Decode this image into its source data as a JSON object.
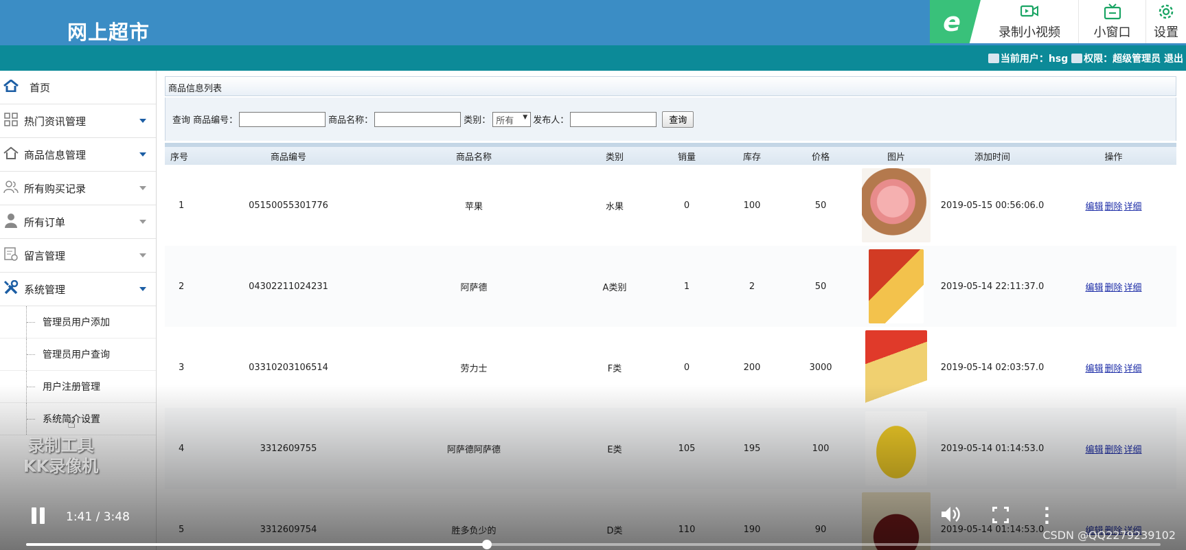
{
  "header": {
    "title": "网上超市",
    "toolbar": {
      "logo": "e",
      "record_label": "录制小视频",
      "mini_label": "小窗口",
      "settings_label": "设置"
    }
  },
  "userbar": {
    "user_label": "当前用户：hsg",
    "role_label": "权限：超级管理员",
    "logout_label": "退出"
  },
  "sidebar": {
    "items": [
      {
        "label": "首页"
      },
      {
        "label": "热门资讯管理"
      },
      {
        "label": "商品信息管理"
      },
      {
        "label": "所有购买记录"
      },
      {
        "label": "所有订单"
      },
      {
        "label": "留言管理"
      },
      {
        "label": "系统管理"
      }
    ],
    "subitems": [
      {
        "label": "管理员用户添加"
      },
      {
        "label": "管理员用户查询"
      },
      {
        "label": "用户注册管理"
      },
      {
        "label": "系统简介设置"
      }
    ]
  },
  "main": {
    "panel_title": "商品信息列表",
    "search": {
      "query_label": "查询",
      "code_label": "商品编号：",
      "code_value": "",
      "name_label": "商品名称：",
      "name_value": "",
      "category_label": "类别：",
      "category_selected": "所有",
      "publisher_label": "发布人：",
      "publisher_value": "",
      "button_label": "查询"
    },
    "columns": [
      "序号",
      "商品编号",
      "商品名称",
      "类别",
      "销量",
      "库存",
      "价格",
      "图片",
      "添加时间",
      "操作"
    ],
    "rows": [
      {
        "idx": "1",
        "code": "05150055301776",
        "name": "苹果",
        "category": "水果",
        "sales": "0",
        "stock": "100",
        "price": "50",
        "image": "apple",
        "time": "2019-05-15 00:56:06.0"
      },
      {
        "idx": "2",
        "code": "04302211024231",
        "name": "阿萨德",
        "category": "A类别",
        "sales": "1",
        "stock": "2",
        "price": "50",
        "image": "snack",
        "time": "2019-05-14 22:11:37.0"
      },
      {
        "idx": "3",
        "code": "03310203106514",
        "name": "劳力士",
        "category": "F类",
        "sales": "0",
        "stock": "200",
        "price": "3000",
        "image": "chips",
        "time": "2019-05-14 02:03:57.0"
      },
      {
        "idx": "4",
        "code": "3312609755",
        "name": "阿萨德阿萨德",
        "category": "E类",
        "sales": "105",
        "stock": "195",
        "price": "100",
        "image": "banana",
        "time": "2019-05-14 01:14:53.0"
      },
      {
        "idx": "5",
        "code": "3312609754",
        "name": "胜多负少的",
        "category": "D类",
        "sales": "110",
        "stock": "190",
        "price": "90",
        "image": "berry",
        "time": "2019-05-14 01:14:53.0"
      }
    ],
    "ops": {
      "edit": "编辑",
      "delete": "删除",
      "detail": "详细"
    }
  },
  "video": {
    "watermark_line1": "录制工具",
    "watermark_line2": "KK录像机",
    "time": "1:41 / 3:48",
    "progress": 0.406,
    "csdn": "CSDN @QQ2279239102"
  }
}
